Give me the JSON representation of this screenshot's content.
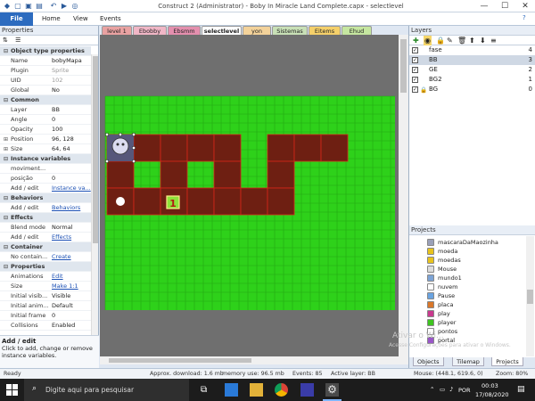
{
  "window": {
    "title": "Construct 2 (Administrator) - Boby In Miracle Land Complete.capx - selectlevel",
    "min_label": "—",
    "max_label": "☐",
    "close_label": "✕"
  },
  "ribbon": {
    "file_label": "File",
    "tabs": [
      "Home",
      "View",
      "Events"
    ]
  },
  "properties": {
    "panel_title": "Properties",
    "rows": [
      {
        "type": "section",
        "label": "Object type properties"
      },
      {
        "key": "Name",
        "value": "bobyMapa"
      },
      {
        "key": "Plugin",
        "value": "Sprite",
        "dim": true
      },
      {
        "key": "UID",
        "value": "102",
        "dim": true
      },
      {
        "key": "Global",
        "value": "No"
      },
      {
        "type": "section",
        "label": "Common"
      },
      {
        "key": "Layer",
        "value": "BB"
      },
      {
        "key": "Angle",
        "value": "0"
      },
      {
        "key": "Opacity",
        "value": "100"
      },
      {
        "key": "Position",
        "value": "96, 128",
        "expand": true
      },
      {
        "key": "Size",
        "value": "64, 64",
        "expand": true
      },
      {
        "type": "section",
        "label": "Instance variables"
      },
      {
        "key": "moviment...",
        "value": ""
      },
      {
        "key": "posição",
        "value": "0"
      },
      {
        "key": "Add / edit",
        "value": "Instance va...",
        "link": true
      },
      {
        "type": "section",
        "label": "Behaviors"
      },
      {
        "key": "Add / edit",
        "value": "Behaviors",
        "link": true
      },
      {
        "type": "section",
        "label": "Effects"
      },
      {
        "key": "Blend mode",
        "value": "Normal"
      },
      {
        "key": "Add / edit",
        "value": "Effects",
        "link": true
      },
      {
        "type": "section",
        "label": "Container"
      },
      {
        "key": "No contain...",
        "value": "Create",
        "link": true
      },
      {
        "type": "section",
        "label": "Properties"
      },
      {
        "key": "Animations",
        "value": "Edit",
        "link": true
      },
      {
        "key": "Size",
        "value": "Make 1:1",
        "link": true
      },
      {
        "key": "Initial visib...",
        "value": "Visible"
      },
      {
        "key": "Initial anim...",
        "value": "Default"
      },
      {
        "key": "Initial frame",
        "value": "0"
      },
      {
        "key": "Collisions",
        "value": "Enabled"
      }
    ],
    "description_title": "Add / edit",
    "description_text": "Click to add, change or remove instance variables."
  },
  "editor_tabs": [
    {
      "label": "level 1",
      "color": "#e9a2a2"
    },
    {
      "label": "Ebobby",
      "color": "#f0b6c6"
    },
    {
      "label": "Ebsmm",
      "color": "#e48fae"
    },
    {
      "label": "selectlevel",
      "color": "#ffffff",
      "active": true
    },
    {
      "label": "yon",
      "color": "#f3d29a"
    },
    {
      "label": "Sistemas",
      "color": "#c8e0b6"
    },
    {
      "label": "Eitems",
      "color": "#f5d06a"
    },
    {
      "label": "Ehud",
      "color": "#c5e6a0"
    }
  ],
  "map": {
    "selected_object": "bobyMapa",
    "level_marker_label": "1",
    "path_color": "#6e1f12",
    "grass_color": "#2ed11a"
  },
  "layers": {
    "panel_title": "Layers",
    "items": [
      {
        "name": "fase",
        "index": "4",
        "checked": true,
        "locked": false
      },
      {
        "name": "BB",
        "index": "3",
        "checked": true,
        "locked": false,
        "selected": true
      },
      {
        "name": "GE",
        "index": "2",
        "checked": true,
        "locked": false
      },
      {
        "name": "BG2",
        "index": "1",
        "checked": true,
        "locked": false
      },
      {
        "name": "BG",
        "index": "0",
        "checked": true,
        "locked": true
      }
    ]
  },
  "projects": {
    "panel_title": "Projects",
    "items": [
      {
        "name": "mascaraDaMaozinha",
        "color": "#9aa0b8"
      },
      {
        "name": "moeda",
        "color": "#e8c31d"
      },
      {
        "name": "moedas",
        "color": "#e8c31d"
      },
      {
        "name": "Mouse",
        "color": "#dddddd"
      },
      {
        "name": "mundo1",
        "color": "#7da4d6"
      },
      {
        "name": "nuvem",
        "color": "#ffffff"
      },
      {
        "name": "Pause",
        "color": "#6aa3e0"
      },
      {
        "name": "placa",
        "color": "#d9772a"
      },
      {
        "name": "play",
        "color": "#c83a8e"
      },
      {
        "name": "player",
        "color": "#3ec41f"
      },
      {
        "name": "pontos",
        "color": "#ffffff"
      },
      {
        "name": "portal",
        "color": "#9a56c8"
      }
    ],
    "tabs": [
      "Objects",
      "Tilemap",
      "Projects"
    ]
  },
  "watermark": {
    "line1": "Ativar o Wi...",
    "line2": "Acesse Configurações para ativar o Windows."
  },
  "status": {
    "ready": "Ready",
    "download": "Approx. download: 1.6 mb",
    "memory": "memory use: 96.5 mb",
    "events": "Events: 85",
    "active_layer": "Active layer: BB",
    "mouse": "Mouse: (448.1, 619.6, 0)",
    "zoom": "Zoom: 80%"
  },
  "taskbar": {
    "search_placeholder": "Digite aqui para pesquisar",
    "language": "POR",
    "time": "00:03",
    "date": "17/08/2020"
  }
}
